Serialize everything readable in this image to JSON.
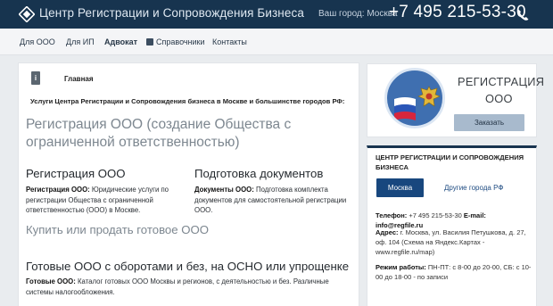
{
  "header": {
    "site_title": "Центр Регистрации и Сопровождения Бизнеса",
    "city_label": "Ваш город: Москва",
    "phone": "+7 495 215-53-30",
    "logo_icon": "diamond-logo-icon",
    "phone_icon": "phone-handset-icon"
  },
  "nav": {
    "items": [
      {
        "label": "Для ООО"
      },
      {
        "label": "Для ИП"
      },
      {
        "label": "Адвокат"
      },
      {
        "label": "Справочники"
      },
      {
        "label": "Контакты"
      }
    ]
  },
  "main": {
    "info_icon": "i",
    "breadcrumb": "Главная",
    "intro": "Услуги Центра Регистрации и Сопровождения бизнеса в Москве и большинстве городов РФ:",
    "section_title": "Регистрация ООО (создание Общества с ограниченной ответственностью)",
    "col1": {
      "title": "Регистрация ООО",
      "text_bold": "Регистрация ООО:",
      "text": " Юридические услуги по регистрации Общества с ограниченной ответственностью (ООО) в Москве."
    },
    "col2": {
      "title": "Подготовка документов",
      "text_bold": "Документы ООО:",
      "text": " Подготовка комплекта документов для самостоятельной регистрации ООО."
    },
    "buy_title": "Купить или продать готовое ООО",
    "ready_title": "Готовые ООО с оборотами и без, на ОСНО или упрощенке",
    "ready_text_bold": "Готовые ООО:",
    "ready_text": " Каталог готовых ООО Москвы и регионов, с деятельностью и без. Различные системы налогообложения."
  },
  "promo": {
    "title": "РЕГИСТРАЦИЯ",
    "subtitle": "ООО",
    "button": "Заказать"
  },
  "info": {
    "title": "ЦЕНТР РЕГИСТРАЦИИ И СОПРОВОЖДЕНИЯ БИЗНЕСА",
    "tab_active": "Москва",
    "tab_other": "Другие города РФ",
    "phone_label": "Телефон:",
    "phone_value": " +7 495 215-53-30 ",
    "email_label": "E-mail:",
    "email_value": " info@regfile.ru",
    "address_label": "Адрес:",
    "address_value": " г. Москва, ул. Василия Петушкова, д. 27, оф. 104 (Схема на Яндекс.Картах - www.regfile.ru/map)",
    "hours_label": "Режим работы:",
    "hours_value": " ПН-ПТ: с 8-00 до 20-00, СБ: с 10-00 до 18-00 - по записи"
  },
  "colors": {
    "header_bg": "#17344f",
    "accent_blue": "#18477e",
    "button_bg": "#a8bacd"
  }
}
